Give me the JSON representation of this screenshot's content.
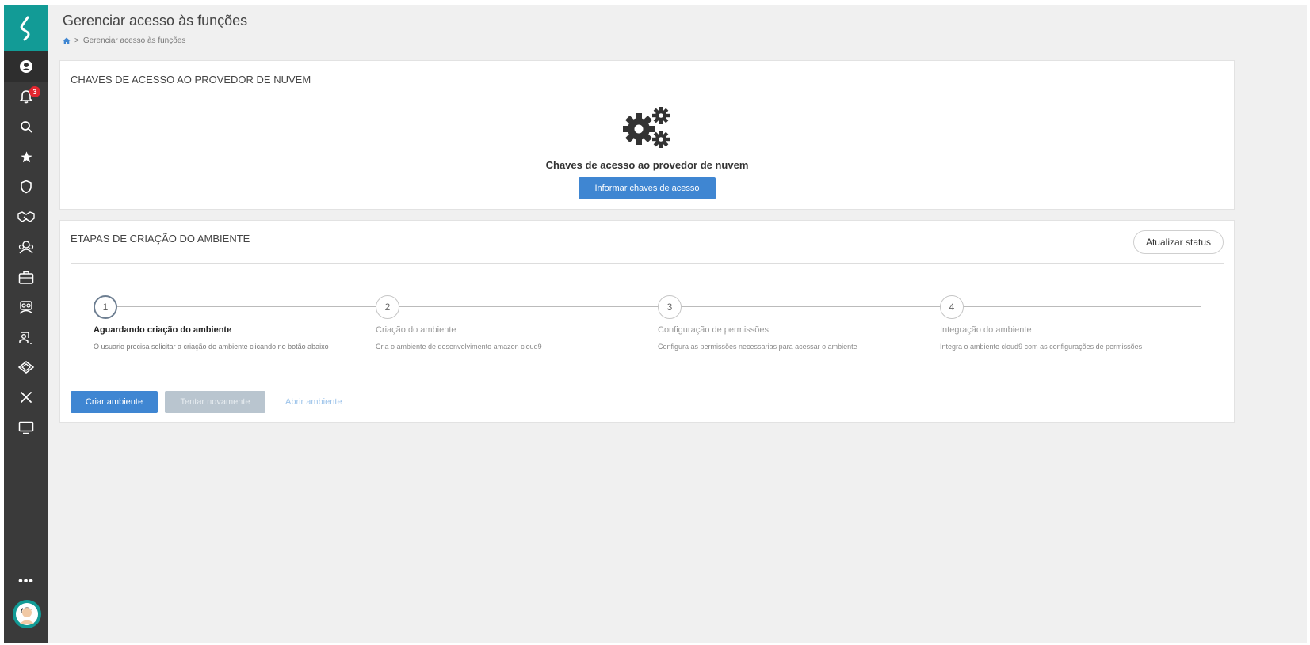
{
  "page": {
    "title": "Gerenciar acesso às funções",
    "breadcrumb": [
      "home-icon",
      "Gerenciar acesso às funções"
    ]
  },
  "sidebar": {
    "logo": "app-logo-icon",
    "items": [
      {
        "icon": "user-circle-icon"
      },
      {
        "icon": "bell-icon",
        "badge": "3"
      },
      {
        "icon": "search-icon"
      },
      {
        "icon": "star-icon"
      },
      {
        "icon": "shield-icon"
      },
      {
        "icon": "handshake-icon"
      },
      {
        "icon": "team-icon"
      },
      {
        "icon": "briefcase-icon"
      },
      {
        "icon": "group-icon"
      },
      {
        "icon": "person-board-icon"
      },
      {
        "icon": "partnership-icon"
      },
      {
        "icon": "tools-icon"
      },
      {
        "icon": "monitor-icon"
      }
    ],
    "more_label": "•••"
  },
  "cloud_keys": {
    "header": "CHAVES DE ACESSO AO PROVEDOR DE NUVEM",
    "icon": "gears-icon",
    "title": "Chaves de acesso ao provedor de nuvem",
    "button": "Informar chaves de acesso"
  },
  "environment": {
    "header": "ETAPAS DE CRIAÇÃO DO AMBIENTE",
    "refresh_button": "Atualizar status",
    "steps": [
      {
        "number": "1",
        "title": "Aguardando criação do ambiente",
        "description": "O usuario precisa solicitar a criação do ambiente clicando no botão abaixo",
        "active": true
      },
      {
        "number": "2",
        "title": "Criação do ambiente",
        "description": "Cria o ambiente de desenvolvimento amazon cloud9",
        "active": false
      },
      {
        "number": "3",
        "title": "Configuração de permissões",
        "description": "Configura as permissões necessarias para acessar o ambiente",
        "active": false
      },
      {
        "number": "4",
        "title": "Integração do ambiente",
        "description": "Integra o ambiente cloud9 com as configurações de permissões",
        "active": false
      }
    ],
    "actions": {
      "create": "Criar ambiente",
      "retry": "Tentar novamente",
      "open": "Abrir ambiente"
    }
  },
  "colors": {
    "sidebar": "#3a3a3a",
    "brand": "#129b96",
    "primary": "#3f86d2",
    "badge": "#e3262f"
  }
}
